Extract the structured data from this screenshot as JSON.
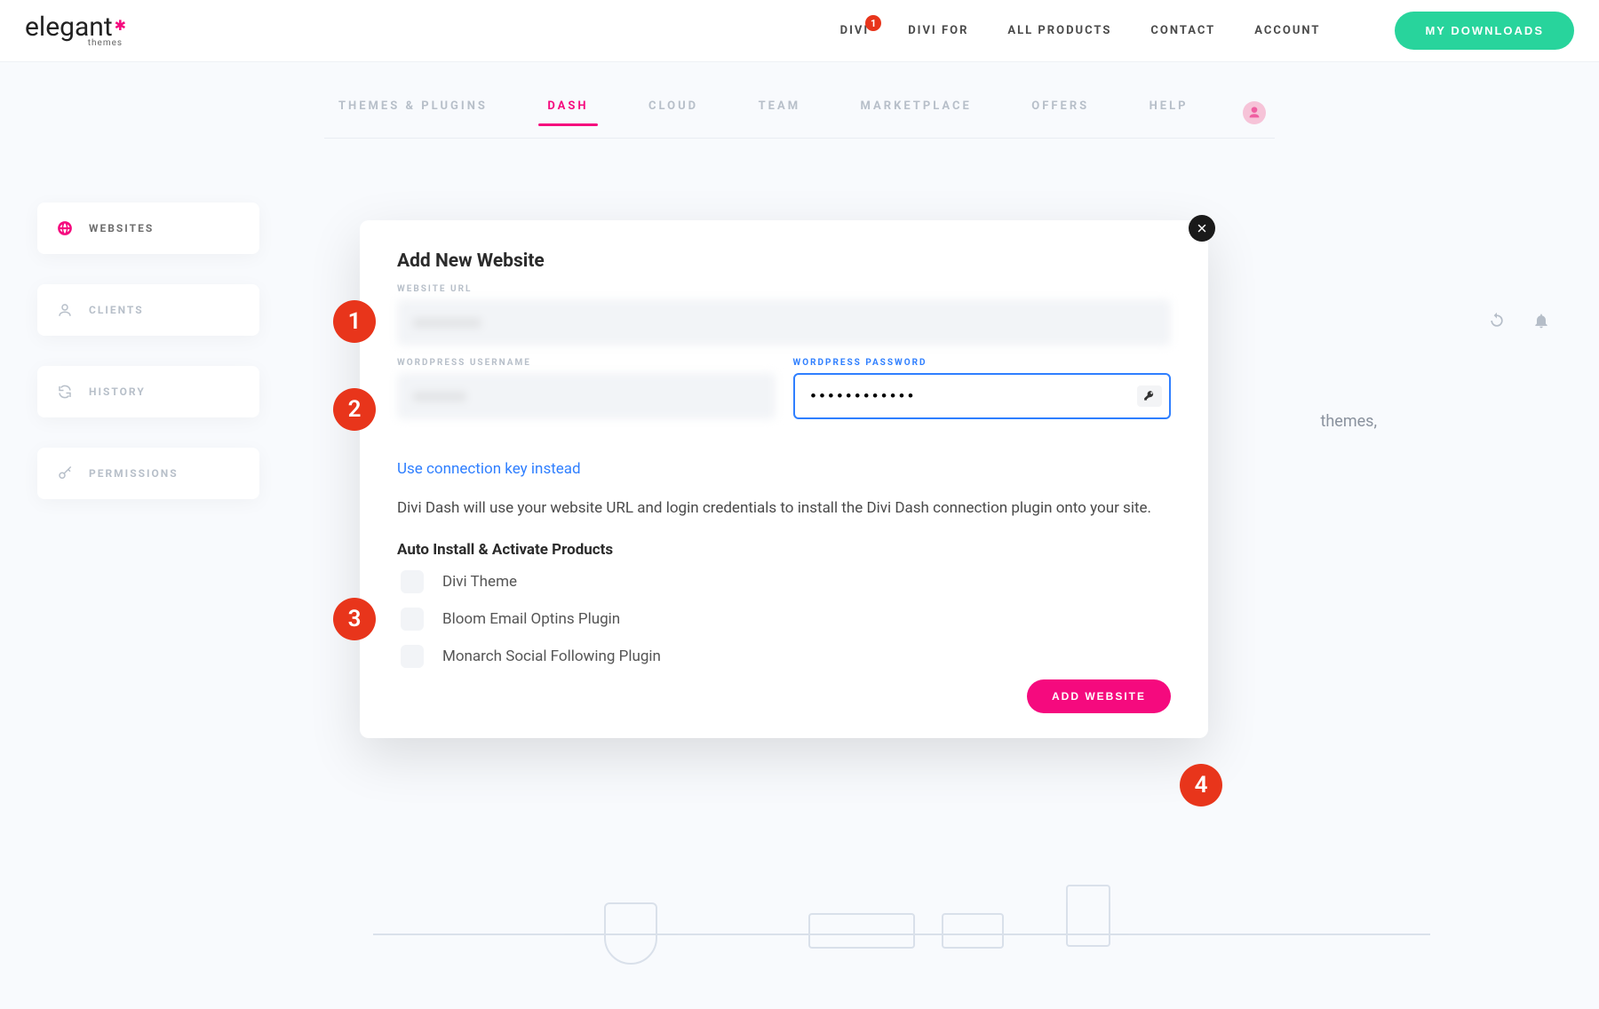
{
  "branding": {
    "word": "elegant",
    "sub": "themes"
  },
  "topnav": {
    "items": [
      {
        "label": "DIVI",
        "badge": "1"
      },
      {
        "label": "DIVI FOR"
      },
      {
        "label": "ALL PRODUCTS"
      },
      {
        "label": "CONTACT"
      },
      {
        "label": "ACCOUNT"
      }
    ],
    "downloads_button": "MY DOWNLOADS"
  },
  "subnav": {
    "items": [
      "THEMES & PLUGINS",
      "DASH",
      "CLOUD",
      "TEAM",
      "MARKETPLACE",
      "OFFERS",
      "HELP"
    ],
    "active_index": 1
  },
  "sidebar": {
    "items": [
      {
        "icon": "globe",
        "label": "WEBSITES",
        "active": true
      },
      {
        "icon": "user",
        "label": "CLIENTS"
      },
      {
        "icon": "refresh",
        "label": "HISTORY"
      },
      {
        "icon": "key",
        "label": "PERMISSIONS"
      }
    ]
  },
  "background_hint_text": "themes,",
  "modal": {
    "title": "Add New Website",
    "url": {
      "label": "WEBSITE URL",
      "placeholder": ""
    },
    "username": {
      "label": "WORDPRESS USERNAME",
      "placeholder": ""
    },
    "password": {
      "label": "WORDPRESS PASSWORD",
      "value": "●●●●●●●●●●●●"
    },
    "link_text": "Use connection key instead",
    "description": "Divi Dash will use your website URL and login credentials to install the Divi Dash connection plugin onto your site.",
    "auto_title": "Auto Install & Activate Products",
    "checks": [
      "Divi Theme",
      "Bloom Email Optins Plugin",
      "Monarch Social Following Plugin"
    ],
    "submit_label": "ADD WEBSITE"
  },
  "annotations": [
    "1",
    "2",
    "3",
    "4"
  ],
  "colors": {
    "brand_pink": "#f50a7e",
    "accent_green": "#28d49c",
    "accent_blue": "#2f7fff",
    "anno_red": "#e8351b"
  }
}
